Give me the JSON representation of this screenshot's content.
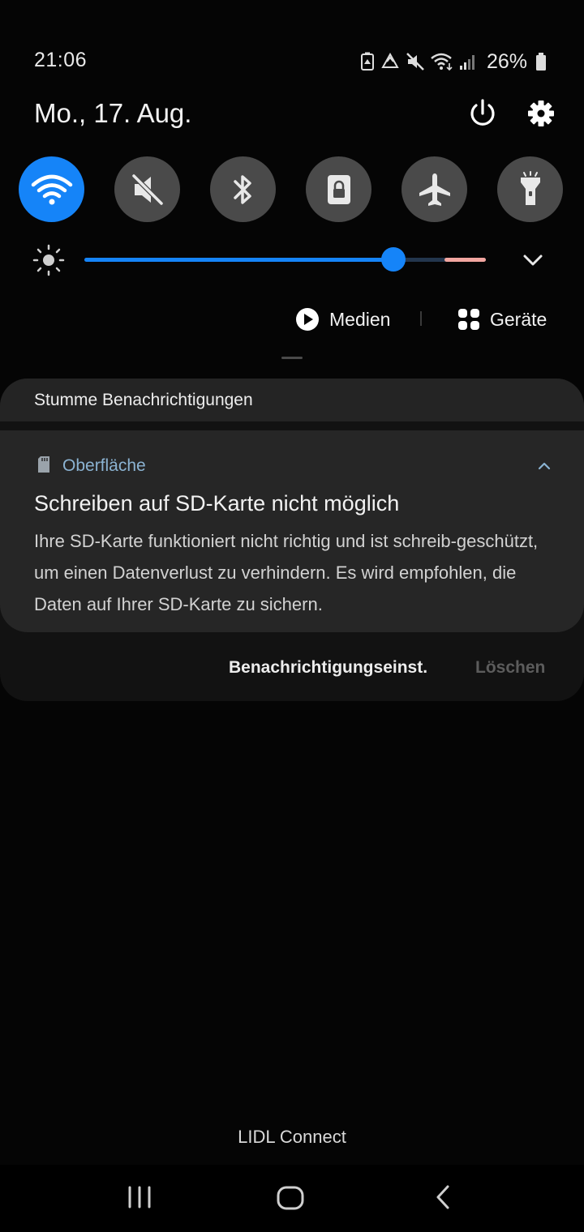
{
  "status_bar": {
    "time": "21:06",
    "icons": [
      "battery-saver-icon",
      "recycle-icon",
      "mute-icon",
      "wifi-icon",
      "signal-icon"
    ],
    "battery_percent": "26%"
  },
  "header": {
    "date": "Mo., 17. Aug.",
    "power_icon": "power-icon",
    "settings_icon": "gear-icon"
  },
  "quick_toggles": [
    {
      "icon": "wifi-icon",
      "state": "on"
    },
    {
      "icon": "mute-icon",
      "state": "off"
    },
    {
      "icon": "bluetooth-icon",
      "state": "off"
    },
    {
      "icon": "rotation-lock-icon",
      "state": "off"
    },
    {
      "icon": "airplane-icon",
      "state": "off"
    },
    {
      "icon": "flashlight-icon",
      "state": "off"
    }
  ],
  "brightness": {
    "level": 0.77,
    "accent": "#1584f8"
  },
  "media_controls": {
    "media_label": "Medien",
    "devices_label": "Geräte"
  },
  "notifications": {
    "section_title": "Stumme Benachrichtigungen",
    "card": {
      "app_name": "Oberfläche",
      "title": "Schreiben auf SD-Karte nicht möglich",
      "body": "Ihre SD-Karte funktioniert nicht richtig und ist schreib-geschützt, um einen Datenverlust zu verhindern. Es wird empfohlen, die Daten auf Ihrer SD-Karte zu sichern."
    },
    "settings_label": "Benachrichtigungseinst.",
    "clear_label": "Löschen"
  },
  "carrier": "LIDL Connect",
  "colors": {
    "accent": "#1584f8",
    "toggle_off": "#4a4a4a",
    "app_name": "#8bb3d2"
  }
}
